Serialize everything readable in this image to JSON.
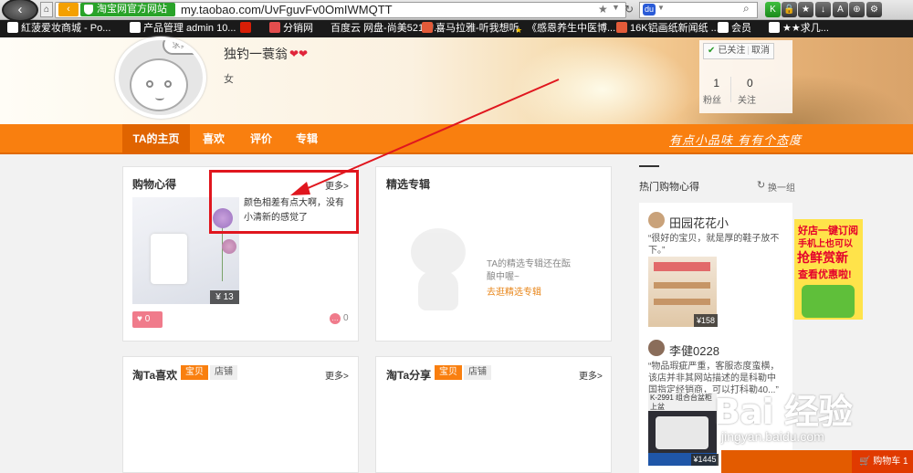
{
  "browser": {
    "site_badge": "淘宝网官方网站",
    "url": "my.taobao.com/UvFguvFv0OmIWMQTT",
    "toolbar_icons": [
      "k-icon",
      "lock-icon",
      "star-icon",
      "download-icon",
      "font-icon",
      "zoom-icon",
      "gear-icon"
    ],
    "toolbar_glyphs": [
      "K",
      "🔒",
      "★",
      "↓",
      "A",
      "⊕",
      "⚙"
    ]
  },
  "bookmarks": [
    {
      "label": "紅菠爱妆商城 - Po...",
      "icon": "page-icon",
      "color": "#ffffff"
    },
    {
      "label": "产品管理 admin 10...",
      "icon": "page-icon",
      "color": "#ffffff"
    },
    {
      "label": "",
      "icon": "baidu-paw-icon",
      "color": "#d81e06"
    },
    {
      "label": "分销网",
      "icon": "pin-icon",
      "color": "#e34d4d"
    },
    {
      "label": "百度云 网盘-尚美521的...",
      "icon": "",
      "color": ""
    },
    {
      "label": "喜马拉雅-听我想听",
      "icon": "ximalaya-icon",
      "color": "#e35b39"
    },
    {
      "label": "《感恩养生中医博...",
      "icon": "star-icon",
      "color": "#f5c400"
    },
    {
      "label": "16K铝画纸新闻纸 ...",
      "icon": "taobao-icon",
      "color": "#e35b39"
    },
    {
      "label": "会员",
      "icon": "page-icon",
      "color": "#ffffff"
    },
    {
      "label": "★★求几...",
      "icon": "page-icon",
      "color": "#ffffff"
    }
  ],
  "profile": {
    "avatar_bubble": "求真信",
    "name": "独钓一蓑翁",
    "gender": "女",
    "follow_status": "已关注",
    "unfollow": "取消",
    "fans_count": "1",
    "fans_label": "粉丝",
    "following_count": "0",
    "following_label": "关注"
  },
  "nav": {
    "tabs": [
      "TA的主页",
      "喜欢",
      "评价",
      "专辑"
    ],
    "slogan": "有点小品味 有有个态度"
  },
  "cards": {
    "shopping": {
      "title": "购物心得",
      "more": "更多>",
      "review": "颜色相差有点大啊，没有小清新的感觉了",
      "price": "¥ 13",
      "likes": "0",
      "comments": "0"
    },
    "albums": {
      "title": "精选专辑",
      "empty_text": "TA的精选专辑还在酝酿中喔~",
      "empty_link": "去逛精选专辑"
    },
    "likes": {
      "title": "淘Ta喜欢",
      "tabs": [
        "宝贝",
        "店铺"
      ],
      "more": "更多>"
    },
    "shares": {
      "title": "淘Ta分享",
      "tabs": [
        "宝贝",
        "店铺"
      ],
      "more": "更多>"
    }
  },
  "sidebar": {
    "title": "热门购物心得",
    "refresh": "换一组",
    "items": [
      {
        "user": "田园花花小",
        "text": "“很好的宝贝，就是厚的鞋子放不下。”",
        "price": "¥158"
      },
      {
        "user": "李健0228",
        "text": "“物品瑕疵严重，客服态度蛮横，该店并非其网站描述的是科勒中国指定经销商，可以打科勒40...”",
        "price": "¥1445",
        "img_top": "K-2991 组合台盆柜上盆"
      }
    ]
  },
  "ad": {
    "line1": "好店一键订阅",
    "line2": "手机上也可以",
    "line3": "抢鲜赏新",
    "line4": "查看优惠啦!"
  },
  "watermark": {
    "text": "Bai 经验",
    "url": "jingyan.baidu.com"
  },
  "cart": {
    "label": "购物车",
    "count": "1"
  }
}
